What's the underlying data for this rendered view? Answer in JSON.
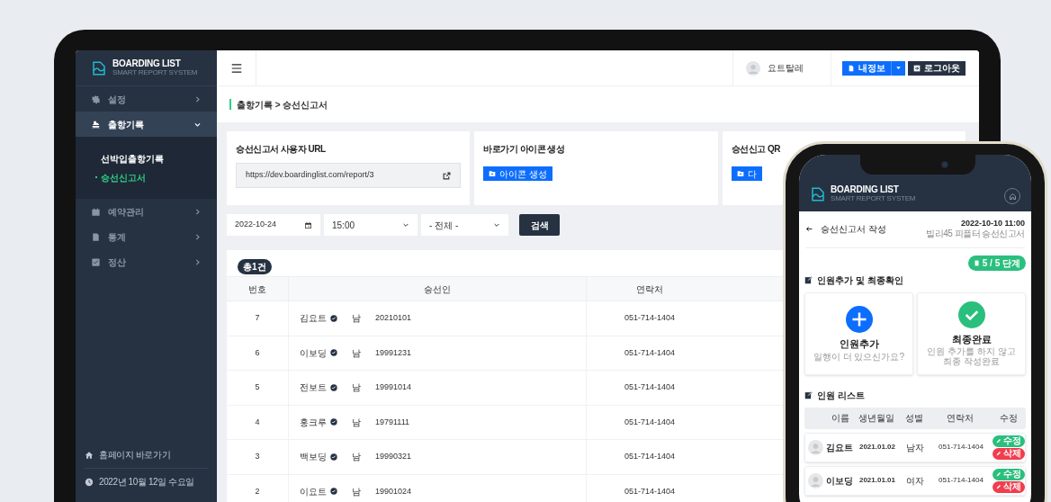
{
  "tablet": {
    "sidebar": {
      "logo": {
        "title": "BOARDING LIST",
        "subtitle": "SMART REPORT SYSTEM"
      },
      "items": [
        {
          "kind": "gear",
          "label": "설정",
          "selected": false,
          "expanded": false
        },
        {
          "kind": "ship",
          "label": "출항기록",
          "selected": true,
          "expanded": true,
          "children": [
            {
              "label": "선박입출항기록",
              "selected": false
            },
            {
              "label": "승선신고서",
              "selected": true
            }
          ]
        },
        {
          "kind": "calendar",
          "label": "예약관리",
          "selected": false,
          "expanded": false
        },
        {
          "kind": "chart",
          "label": "통계",
          "selected": false,
          "expanded": false
        },
        {
          "kind": "check",
          "label": "정산",
          "selected": false,
          "expanded": false
        }
      ],
      "footer": [
        {
          "kind": "home",
          "label": "홈페이지 바로가기"
        },
        {
          "kind": "clock",
          "label": "2022년 10월 12일 수요일"
        }
      ]
    },
    "topbar": {
      "user": "요트탈레",
      "buttons": [
        {
          "kind": "primary",
          "label": "내정보"
        },
        {
          "kind": "dark",
          "label": "로그아웃"
        }
      ]
    },
    "breadcrumb": "출항기록 > 승선신고서",
    "cards": [
      {
        "kind": "url",
        "title": "승선신고서 사용자 URL",
        "value": "https://dev.boardinglist.com/report/3"
      },
      {
        "kind": "button",
        "title": "바로가기 아이콘 생성",
        "button": "아이콘 생성"
      },
      {
        "kind": "button",
        "title": "승선신고 QR",
        "button": "다"
      }
    ],
    "filters": {
      "date": "2022-10-24",
      "time": "15:00",
      "select": "- 전체 -",
      "button": "검색"
    },
    "table": {
      "total": "총1건",
      "columns": [
        "번호",
        "승선인",
        "연락처"
      ],
      "rows": [
        {
          "no": "7",
          "name": "김요트",
          "verified": true,
          "gender": "남",
          "birth": "20210101",
          "phone": "051-714-1404"
        },
        {
          "no": "6",
          "name": "이보딩",
          "verified": true,
          "gender": "남",
          "birth": "19991231",
          "phone": "051-714-1404"
        },
        {
          "no": "5",
          "name": "전보트",
          "verified": true,
          "gender": "남",
          "birth": "19991014",
          "phone": "051-714-1404"
        },
        {
          "no": "4",
          "name": "홍크루",
          "verified": true,
          "gender": "남",
          "birth": "19791111",
          "phone": "051-714-1404"
        },
        {
          "no": "3",
          "name": "백보딩",
          "verified": true,
          "gender": "남",
          "birth": "19990321",
          "phone": "051-714-1404"
        },
        {
          "no": "2",
          "name": "이요트",
          "verified": true,
          "gender": "남",
          "birth": "19901024",
          "phone": "051-714-1404"
        }
      ]
    }
  },
  "phone": {
    "logo": {
      "title": "BOARDING LIST",
      "subtitle": "SMART REPORT SYSTEM"
    },
    "title": "승선신고서 작성",
    "datetime": "2022-10-10 11:00",
    "subtitle": "빌리45 피플터 승선신고서",
    "step": "5 / 5 단계",
    "section1": "인원추가 및 최종확인",
    "actions": [
      {
        "kind": "add",
        "title": "인원추가",
        "desc": "일행이 더 있으신가요?"
      },
      {
        "kind": "done",
        "title": "최종완료",
        "desc": "인원 추가를 하지 않고 최종 작성완료"
      }
    ],
    "section2": "인원 리스트",
    "columns": [
      "이름",
      "생년월일",
      "성별",
      "연락처",
      "수정"
    ],
    "rows": [
      {
        "name": "김요트",
        "birth": "2021.01.02",
        "gender": "남자",
        "phone": "051-714-1404",
        "edit": "수정",
        "delete": "삭제"
      },
      {
        "name": "이보딩",
        "birth": "2021.01.01",
        "gender": "여자",
        "phone": "051-714-1404",
        "edit": "수정",
        "delete": "삭제"
      }
    ]
  }
}
